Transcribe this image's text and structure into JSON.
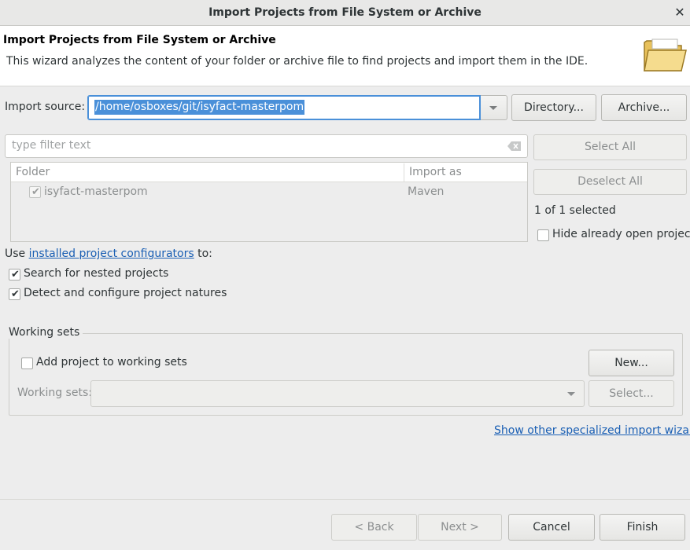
{
  "window": {
    "title": "Import Projects from File System or Archive",
    "close_glyph": "✕"
  },
  "header": {
    "title": "Import Projects from File System or Archive",
    "description": "This wizard analyzes the content of your folder or archive file to find projects and import them in the IDE.",
    "icon": "folder-open-icon"
  },
  "import_source": {
    "label": "Import source:",
    "value": "/home/osboxes/git/isyfact-masterpom",
    "directory_button": "Directory...",
    "archive_button": "Archive..."
  },
  "filter": {
    "placeholder": "type filter text"
  },
  "table": {
    "columns": [
      "Folder",
      "Import as"
    ],
    "rows": [
      {
        "folder": "isyfact-masterpom",
        "import_as": "Maven",
        "checked": true
      }
    ]
  },
  "side": {
    "select_all": "Select All",
    "deselect_all": "Deselect All",
    "selection_status": "1 of 1 selected",
    "hide_open_label": "Hide already open projects",
    "hide_open_checked": false
  },
  "options": {
    "use_prefix": "Use ",
    "configurators_link": "installed project configurators",
    "use_suffix": " to:",
    "search_nested_label": "Search for nested projects",
    "search_nested_checked": true,
    "detect_natures_label": "Detect and configure project natures",
    "detect_natures_checked": true
  },
  "working_sets": {
    "group_label": "Working sets",
    "add_label": "Add project to working sets",
    "add_checked": false,
    "new_button": "New...",
    "sets_label": "Working sets:",
    "select_button": "Select..."
  },
  "other_wizards_link": "Show other specialized import wizards",
  "footer": {
    "back": "< Back",
    "next": "Next >",
    "cancel": "Cancel",
    "finish": "Finish"
  },
  "colors": {
    "accent": "#4a90d9",
    "link": "#1a5fb4",
    "background": "#ededed"
  }
}
